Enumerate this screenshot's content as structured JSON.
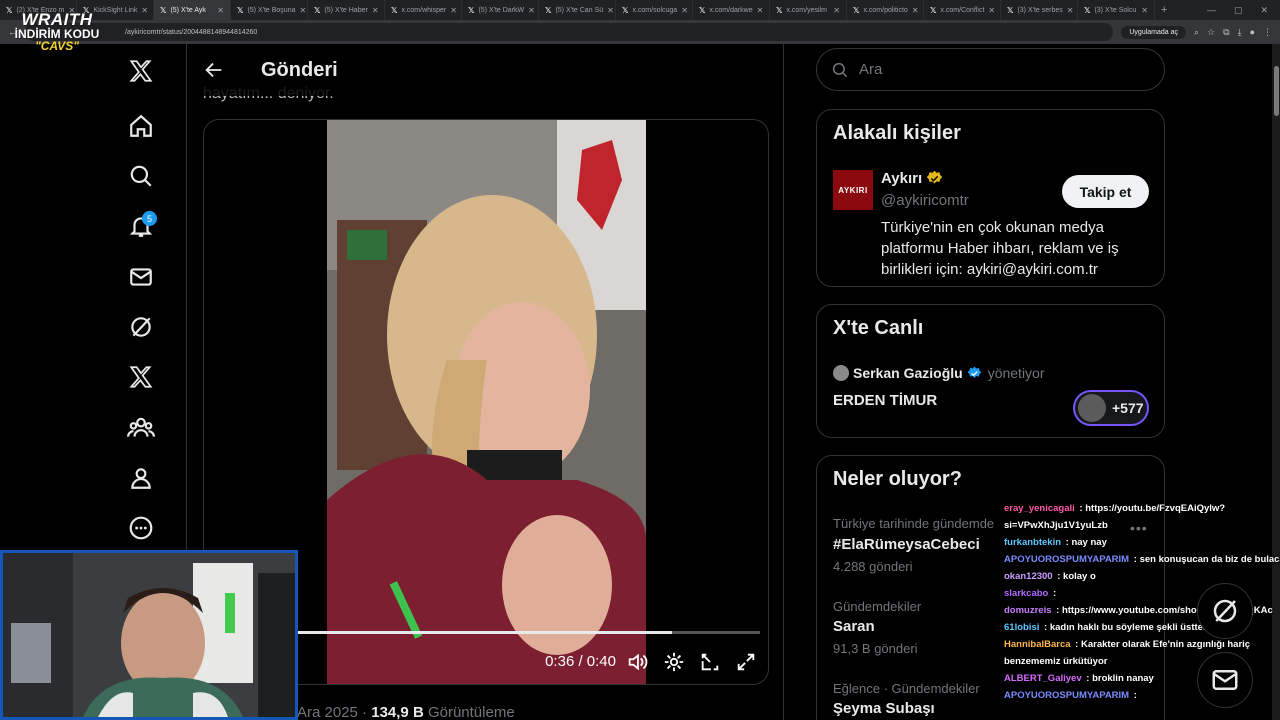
{
  "browser": {
    "tabs": [
      {
        "label": "(2) X'te Enzo m",
        "active": false
      },
      {
        "label": "KickSight Link",
        "active": false
      },
      {
        "label": "(5) X'te Ayk",
        "active": true
      },
      {
        "label": "(5) X'te Boşuna",
        "active": false
      },
      {
        "label": "(5) X'te Haber",
        "active": false
      },
      {
        "label": "x.com/whisper",
        "active": false
      },
      {
        "label": "(5) X'te DarkW",
        "active": false
      },
      {
        "label": "(5) X'te Can Sü",
        "active": false
      },
      {
        "label": "x.com/solcuga",
        "active": false
      },
      {
        "label": "x.com/darkwe",
        "active": false
      },
      {
        "label": "x.com/yesilm",
        "active": false
      },
      {
        "label": "x.com/politicto",
        "active": false
      },
      {
        "label": "x.com/Conflict",
        "active": false
      },
      {
        "label": "(3) X'te serbes",
        "active": false
      },
      {
        "label": "(3) X'te Solcu",
        "active": false
      }
    ],
    "url": "/aykiricomtr/status/2004488148944814260",
    "open_in_app": "Uygulamada aç"
  },
  "overlay": {
    "brand_line1": "WRAITH",
    "brand_line2": "İNDİRİM KODU",
    "brand_line3": "\"CAVS\""
  },
  "nav": {
    "notification_count": "5"
  },
  "post": {
    "header_title": "Gönderi",
    "text_snippet": "hayatım... deniyor.",
    "video_time": "0:36 / 0:40",
    "video_progress": 0.81,
    "date_fragment": "Ara 2025",
    "views_value": "134,9 B",
    "views_label": "Görüntüleme"
  },
  "sidebar": {
    "search_placeholder": "Ara",
    "related": {
      "title": "Alakalı kişiler",
      "name": "Aykırı",
      "handle": "@aykiricomtr",
      "bio": "Türkiye'nin en çok okunan medya platformu Haber ihbarı, reklam ve iş birlikleri için: aykiri@aykiri.com.tr",
      "follow_label": "Takip et",
      "avatar_text": "AYKIRI"
    },
    "live": {
      "title": "X'te Canlı",
      "host": "Serkan Gazioğlu",
      "host_role": "yönetiyor",
      "space_title": "ERDEN TİMUR",
      "listeners": "+577"
    },
    "trends": {
      "title": "Neler oluyor?",
      "items": [
        {
          "category": "Türkiye tarihinde gündemde",
          "name": "#ElaRümeysaCebeci",
          "count": "4.288 gönderi"
        },
        {
          "category": "Gündemdekiler",
          "name": "Saran",
          "count": "91,3 B gönderi"
        },
        {
          "category": "Eğlence · Gündemdekiler",
          "name": "Şeyma Subaşı",
          "count": ""
        }
      ]
    }
  },
  "chat": [
    {
      "user": "eray_yenicagali",
      "color": "#ff5aa8",
      "msg": "https://youtu.be/FzvqEAiQylw?si=VPwXhJju1V1yuLzb",
      "wrap": true
    },
    {
      "user": "furkanbtekin",
      "color": "#5ec8ff",
      "msg": "nay nay",
      "wrap": false
    },
    {
      "user": "APOYUOROSPUMYAPARIM",
      "color": "#7b8cff",
      "msg": "sen konuşucan da biz de bulacaz",
      "wrap": false
    },
    {
      "user": "okan12300",
      "color": "#c9a0ff",
      "msg": "kolay o",
      "wrap": false
    },
    {
      "user": "slarkcabo",
      "color": "#b06bff",
      "msg": "",
      "wrap": false
    },
    {
      "user": "domuzreis",
      "color": "#c77dff",
      "msg": "https://www.youtube.com/shorts/vLZUQsqKAc",
      "wrap": false
    },
    {
      "user": "61lobisi",
      "color": "#5ec8ff",
      "msg": "kadın haklı bu söyleme şekli üstten bakıştır",
      "wrap": false
    },
    {
      "user": "HannibalBarca",
      "color": "#ffb84d",
      "msg": "Karakter olarak Efe'nin azgınlığı hariç benzememiz ürkütüyor",
      "wrap": true
    },
    {
      "user": "ALBERT_Galiyev",
      "color": "#d76bff",
      "msg": "broklin nanay",
      "wrap": false
    },
    {
      "user": "APOYUOROSPUMYAPARIM",
      "color": "#7b8cff",
      "msg": "",
      "wrap": false
    }
  ]
}
